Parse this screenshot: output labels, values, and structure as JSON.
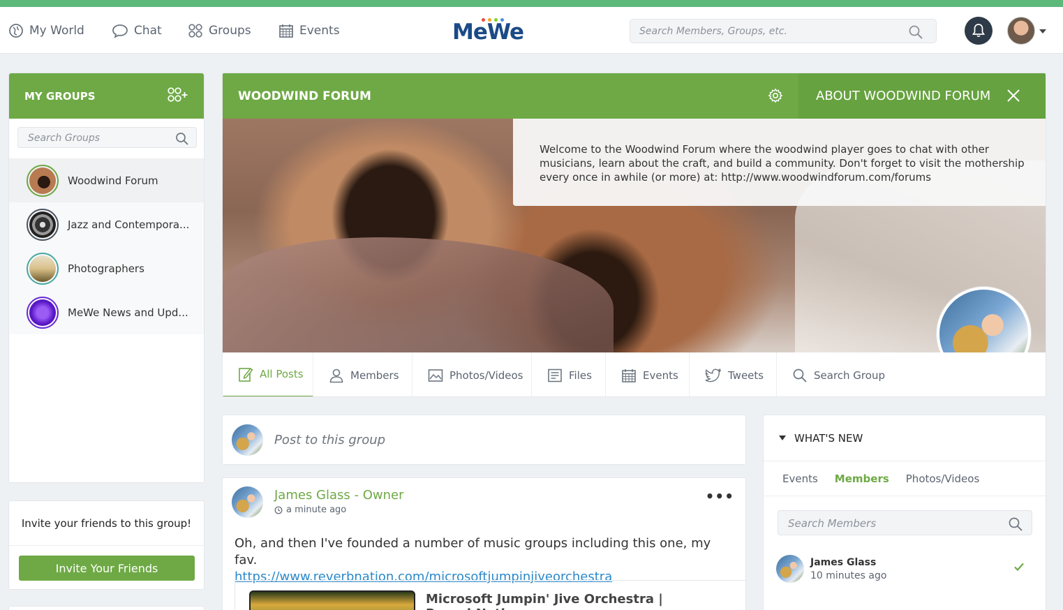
{
  "nav": {
    "my_world": "My World",
    "chat": "Chat",
    "groups": "Groups",
    "events": "Events",
    "logo": "MeWe",
    "search_placeholder": "Search Members, Groups, etc."
  },
  "sidebar": {
    "title": "MY GROUPS",
    "search_placeholder": "Search Groups",
    "groups": [
      {
        "name": "Woodwind Forum",
        "ring": "#6ea945"
      },
      {
        "name": "Jazz and Contempora...",
        "ring": "#4a5560"
      },
      {
        "name": "Photographers",
        "ring": "#4aa8a0"
      },
      {
        "name": "MeWe News and Upd...",
        "ring": "#6a2bd9"
      }
    ],
    "invite_text": "Invite your friends to this group!",
    "invite_button": "Invite Your Friends"
  },
  "group": {
    "title": "WOODWIND FORUM",
    "about_title": "ABOUT WOODWIND FORUM",
    "about_text": "Welcome to the Woodwind Forum where the woodwind player goes to chat with other musicians, learn about the craft, and build a community. Don't forget to visit the mothership every once in awhile (or more) at: http://www.woodwindforum.com/forums",
    "tabs": [
      "All Posts",
      "Members",
      "Photos/Videos",
      "Files",
      "Events",
      "Tweets",
      "Search Group"
    ]
  },
  "composer": {
    "placeholder": "Post to this group"
  },
  "post": {
    "author": "James Glass - Owner",
    "time": "a minute ago",
    "more": "•••",
    "text": "Oh, and then I've founded a number of music groups including this one, my fav.",
    "link": "https://www.reverbnation.com/microsoftjumpinjiveorchestra",
    "preview_title": "Microsoft Jumpin' Jive Orchestra | ReverbNation"
  },
  "whats_new": {
    "title": "WHAT'S NEW",
    "tabs": [
      "Events",
      "Members",
      "Photos/Videos"
    ],
    "search_placeholder": "Search Members",
    "member_name": "James Glass",
    "member_time": "10 minutes ago"
  },
  "colors": {
    "brand_green": "#6ea945",
    "top_strip": "#5cb97a",
    "link_blue": "#2a88c9"
  }
}
